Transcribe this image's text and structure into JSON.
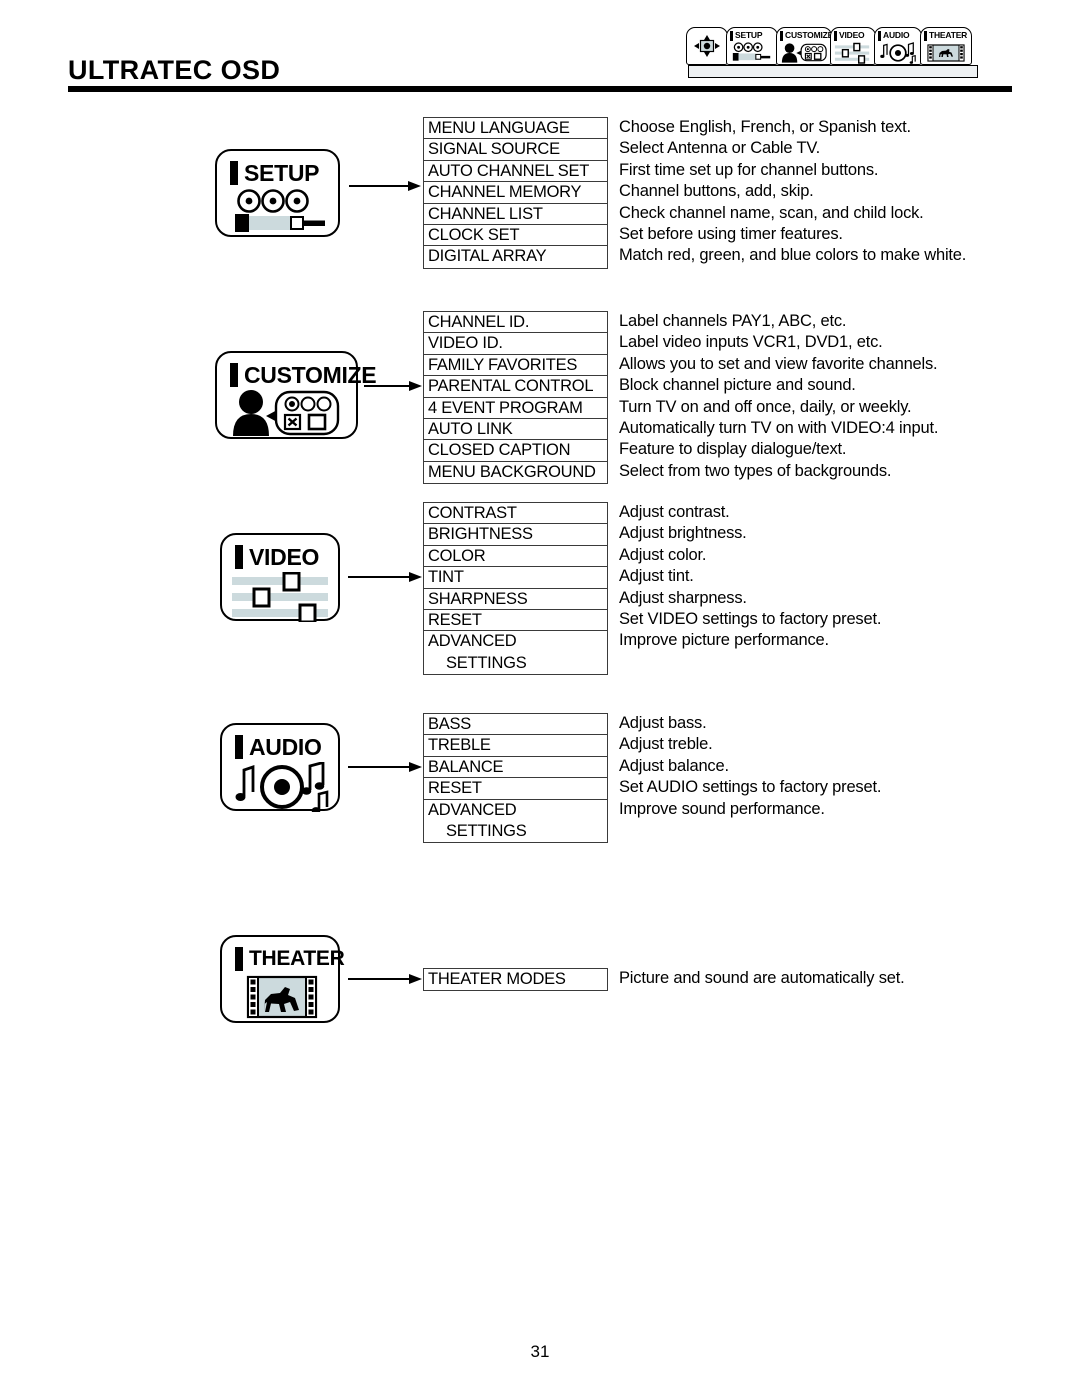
{
  "header": {
    "title": "ULTRATEC OSD",
    "tabs": [
      {
        "name": "navigation",
        "label": "",
        "icon": "dpad-icon"
      },
      {
        "name": "setup",
        "label": "SETUP",
        "icon": "camera-reels-icon"
      },
      {
        "name": "customize",
        "label": "CUSTOMIZE",
        "icon": "person-options-icon"
      },
      {
        "name": "video",
        "label": "VIDEO",
        "icon": "sliders-icon"
      },
      {
        "name": "audio",
        "label": "AUDIO",
        "icon": "music-disc-icon"
      },
      {
        "name": "theater",
        "label": "THEATER",
        "icon": "film-horse-icon"
      }
    ]
  },
  "sections": [
    {
      "id": "setup",
      "card_label": "SETUP",
      "card_icon": "camera-reels-icon",
      "items": [
        {
          "label": "MENU LANGUAGE",
          "desc": "Choose English, French, or Spanish text."
        },
        {
          "label": "SIGNAL SOURCE",
          "desc": "Select Antenna or Cable TV."
        },
        {
          "label": "AUTO CHANNEL SET",
          "desc": "First time set up for channel buttons."
        },
        {
          "label": "CHANNEL MEMORY",
          "desc": "Channel buttons, add, skip."
        },
        {
          "label": "CHANNEL LIST",
          "desc": "Check channel name, scan, and child lock."
        },
        {
          "label": "CLOCK SET",
          "desc": "Set before using timer features."
        },
        {
          "label": "DIGITAL ARRAY",
          "desc": "Match red, green, and blue colors to make white."
        }
      ]
    },
    {
      "id": "customize",
      "card_label": "CUSTOMIZE",
      "card_icon": "person-options-icon",
      "items": [
        {
          "label": "CHANNEL ID.",
          "desc": "Label channels PAY1, ABC, etc."
        },
        {
          "label": "VIDEO ID.",
          "desc": "Label video inputs VCR1, DVD1, etc."
        },
        {
          "label": "FAMILY FAVORITES",
          "desc": "Allows you to set and view favorite channels."
        },
        {
          "label": "PARENTAL CONTROL",
          "desc": "Block channel picture and sound."
        },
        {
          "label": "4 EVENT PROGRAM",
          "desc": "Turn TV on and off once, daily, or weekly."
        },
        {
          "label": "AUTO LINK",
          "desc": "Automatically turn TV on with VIDEO:4 input."
        },
        {
          "label": "CLOSED CAPTION",
          "desc": "Feature to display dialogue/text."
        },
        {
          "label": "MENU BACKGROUND",
          "desc": "Select from two types of backgrounds."
        }
      ]
    },
    {
      "id": "video",
      "card_label": "VIDEO",
      "card_icon": "sliders-icon",
      "items": [
        {
          "label": "CONTRAST",
          "desc": "Adjust contrast."
        },
        {
          "label": "BRIGHTNESS",
          "desc": "Adjust brightness."
        },
        {
          "label": "COLOR",
          "desc": "Adjust color."
        },
        {
          "label": "TINT",
          "desc": "Adjust tint."
        },
        {
          "label": "SHARPNESS",
          "desc": "Adjust sharpness."
        },
        {
          "label": "RESET",
          "desc": "Set VIDEO settings to factory preset."
        },
        {
          "label": "ADVANCED",
          "desc": "Improve picture performance."
        },
        {
          "label": "SETTINGS",
          "desc": "",
          "sub": true
        }
      ]
    },
    {
      "id": "audio",
      "card_label": "AUDIO",
      "card_icon": "music-disc-icon",
      "items": [
        {
          "label": "BASS",
          "desc": "Adjust bass."
        },
        {
          "label": "TREBLE",
          "desc": "Adjust treble."
        },
        {
          "label": "BALANCE",
          "desc": "Adjust balance."
        },
        {
          "label": "RESET",
          "desc": "Set AUDIO settings to factory preset."
        },
        {
          "label": "ADVANCED",
          "desc": "Improve sound performance."
        },
        {
          "label": "SETTINGS",
          "desc": "",
          "sub": true
        }
      ]
    },
    {
      "id": "theater",
      "card_label": "THEATER",
      "card_icon": "film-horse-icon",
      "items": [
        {
          "label": "THEATER MODES",
          "desc": "Picture and sound are automatically set."
        }
      ]
    }
  ],
  "footer": {
    "page_number": "31"
  },
  "colors": {
    "ink": "#000000",
    "rule": "#3a3a3a",
    "icon_fill": "#ccdadd",
    "tab_band": "#eef1f3"
  }
}
